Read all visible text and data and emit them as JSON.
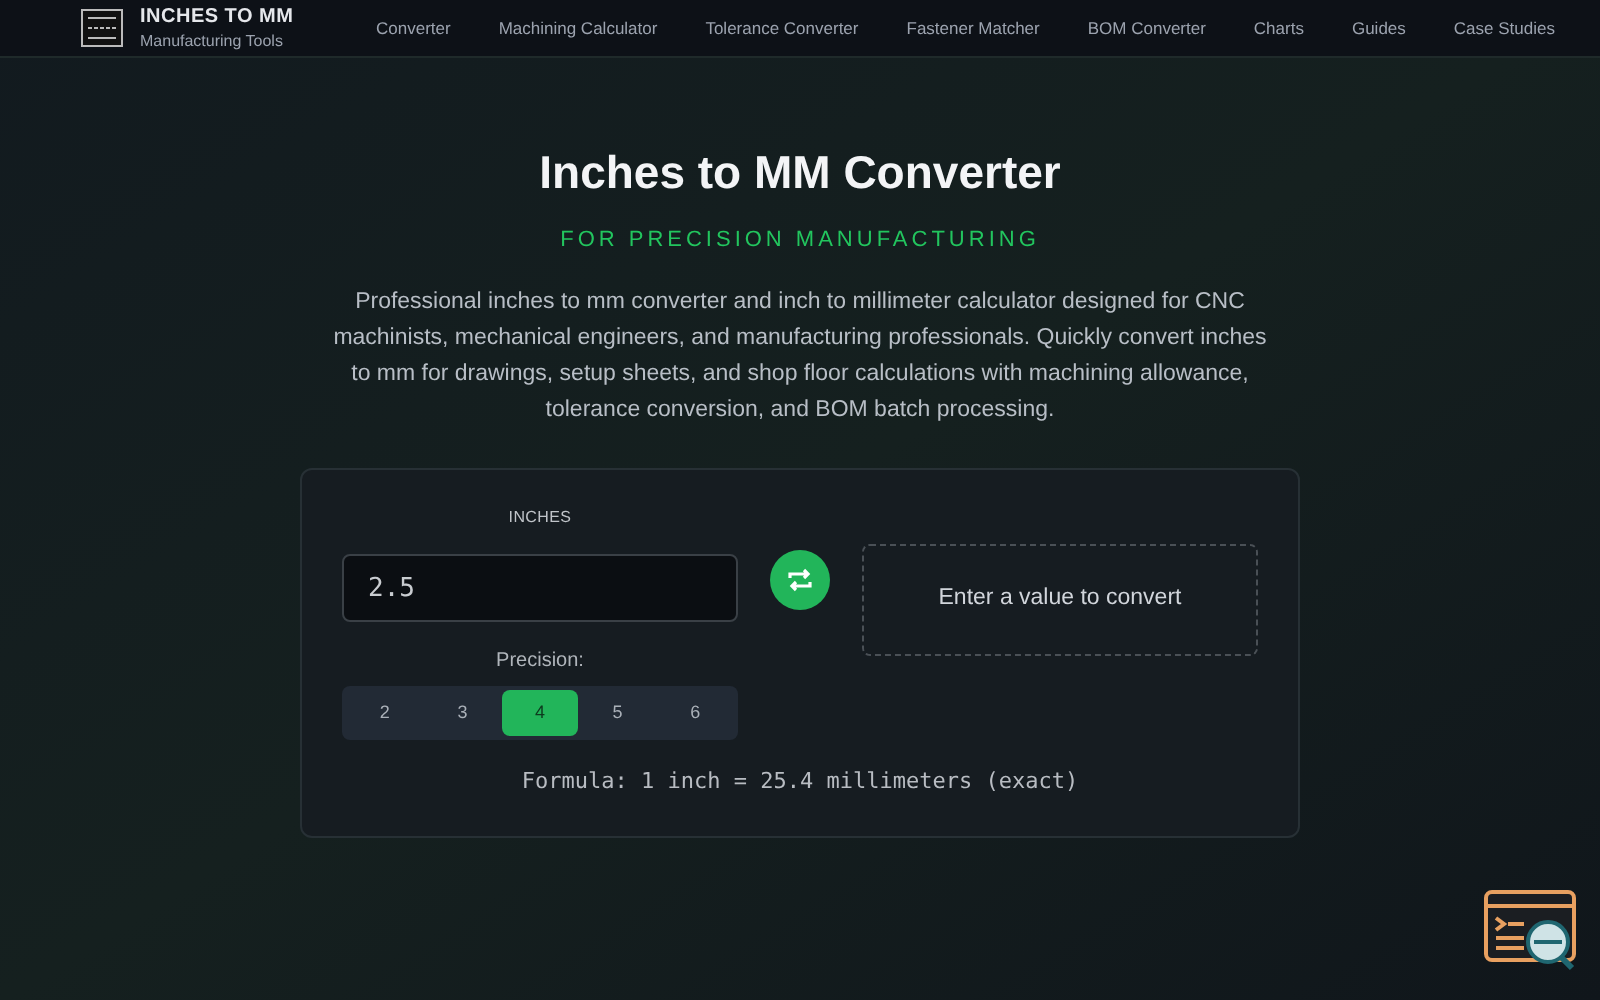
{
  "header": {
    "title": "INCHES TO MM",
    "subtitle": "Manufacturing Tools",
    "nav": [
      {
        "label": "Converter"
      },
      {
        "label": "Machining Calculator"
      },
      {
        "label": "Tolerance Converter"
      },
      {
        "label": "Fastener Matcher"
      },
      {
        "label": "BOM Converter"
      },
      {
        "label": "Charts"
      },
      {
        "label": "Guides"
      },
      {
        "label": "Case Studies"
      }
    ]
  },
  "hero": {
    "title": "Inches to MM Converter",
    "tagline": "FOR PRECISION MANUFACTURING",
    "description": "Professional inches to mm converter and inch to millimeter calculator designed for CNC machinists, mechanical engineers, and manufacturing professionals. Quickly convert inches to mm for drawings, setup sheets, and shop floor calculations with machining allowance, tolerance conversion, and BOM batch processing."
  },
  "converter": {
    "input_label": "INCHES",
    "input_value": "2.5",
    "result": "Enter a value to convert",
    "precision_label": "Precision:",
    "precision": [
      {
        "label": "2",
        "selected": false
      },
      {
        "label": "3",
        "selected": false
      },
      {
        "label": "4",
        "selected": true
      },
      {
        "label": "5",
        "selected": false
      },
      {
        "label": "6",
        "selected": false
      }
    ],
    "formula": "Formula: 1 inch = 25.4 millimeters (exact)"
  }
}
